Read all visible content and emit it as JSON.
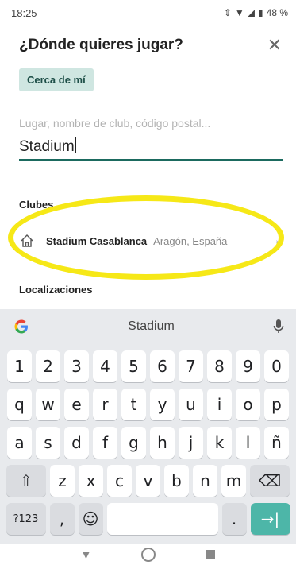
{
  "status_bar": {
    "time": "18:25",
    "battery": "48 %"
  },
  "header": {
    "title": "¿Dónde quieres jugar?",
    "close_icon": "close-icon"
  },
  "near_me_label": "Cerca de mí",
  "search": {
    "placeholder": "Lugar, nombre de club, código postal...",
    "value": "Stadium"
  },
  "sections": {
    "clubs_title": "Clubes",
    "locations_title": "Localizaciones"
  },
  "club": {
    "name": "Stadium Casablanca",
    "location": "Aragón, España"
  },
  "keyboard": {
    "suggestion": "Stadium",
    "rows": [
      [
        "1",
        "2",
        "3",
        "4",
        "5",
        "6",
        "7",
        "8",
        "9",
        "0"
      ],
      [
        "q",
        "w",
        "e",
        "r",
        "t",
        "y",
        "u",
        "i",
        "o",
        "p"
      ],
      [
        "a",
        "s",
        "d",
        "f",
        "g",
        "h",
        "j",
        "k",
        "l",
        "ñ"
      ],
      [
        "⇧",
        "z",
        "x",
        "c",
        "v",
        "b",
        "n",
        "m",
        "⌫"
      ],
      [
        "?123",
        ",",
        "☺",
        " ",
        ".",
        "→|"
      ]
    ]
  },
  "colors": {
    "accent": "#1b6a5f",
    "chip_bg": "#cfe6e1",
    "highlight": "#f6e817",
    "enter_key": "#4db6a8"
  }
}
